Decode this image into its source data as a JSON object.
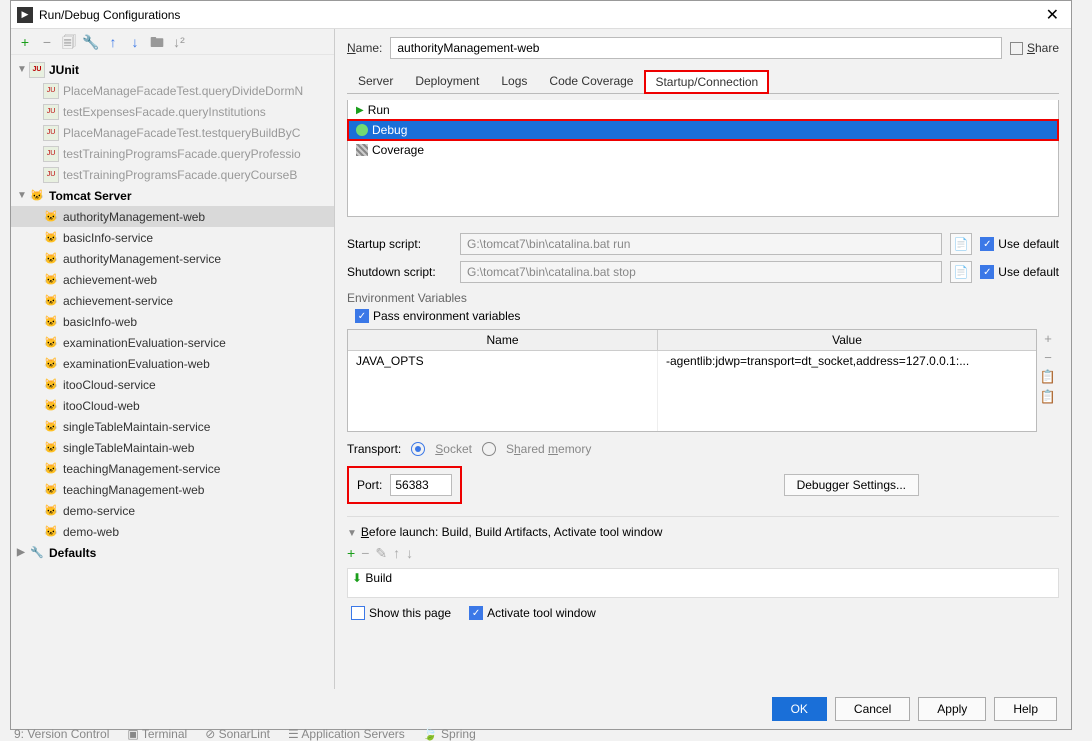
{
  "titlebar": {
    "title": "Run/Debug Configurations"
  },
  "tree": {
    "junit": {
      "label": "JUnit",
      "items": [
        "PlaceManageFacadeTest.queryDivideDormN",
        "testExpensesFacade.queryInstitutions",
        "PlaceManageFacadeTest.testqueryBuildByC",
        "testTrainingProgramsFacade.queryProfessio",
        "testTrainingProgramsFacade.queryCourseB"
      ]
    },
    "tomcat": {
      "label": "Tomcat Server",
      "items": [
        "authorityManagement-web",
        "basicInfo-service",
        "authorityManagement-service",
        "achievement-web",
        "achievement-service",
        "basicInfo-web",
        "examinationEvaluation-service",
        "examinationEvaluation-web",
        "itooCloud-service",
        "itooCloud-web",
        "singleTableMaintain-service",
        "singleTableMaintain-web",
        "teachingManagement-service",
        "teachingManagement-web",
        "demo-service",
        "demo-web"
      ]
    },
    "defaults": {
      "label": "Defaults"
    }
  },
  "form": {
    "nameLabel": "Name:",
    "nameValue": "authorityManagement-web",
    "shareLabel": "Share"
  },
  "tabs": {
    "server": "Server",
    "deployment": "Deployment",
    "logs": "Logs",
    "coverage": "Code Coverage",
    "startup": "Startup/Connection"
  },
  "runlist": {
    "run": "Run",
    "debug": "Debug",
    "coverage": "Coverage"
  },
  "scripts": {
    "startupLabel": "Startup script:",
    "startupVal": "G:\\tomcat7\\bin\\catalina.bat run",
    "shutdownLabel": "Shutdown script:",
    "shutdownVal": "G:\\tomcat7\\bin\\catalina.bat stop",
    "useDefault": "Use default"
  },
  "env": {
    "heading": "Environment Variables",
    "pass": "Pass environment variables",
    "nameHdr": "Name",
    "valueHdr": "Value",
    "row1name": "JAVA_OPTS",
    "row1val": "-agentlib:jdwp=transport=dt_socket,address=127.0.0.1:..."
  },
  "transport": {
    "label": "Transport:",
    "socket": "Socket",
    "shared": "Shared memory"
  },
  "port": {
    "label": "Port:",
    "value": "56383"
  },
  "debugger": {
    "btn": "Debugger Settings..."
  },
  "before": {
    "title": "Before launch: Build, Build Artifacts, Activate tool window",
    "build": "Build",
    "show": "Show this page",
    "activate": "Activate tool window"
  },
  "buttons": {
    "ok": "OK",
    "cancel": "Cancel",
    "apply": "Apply",
    "help": "Help"
  },
  "underline": {
    "n": "N",
    "s": "S",
    "h": "h",
    "m": "m",
    "b": "B"
  }
}
